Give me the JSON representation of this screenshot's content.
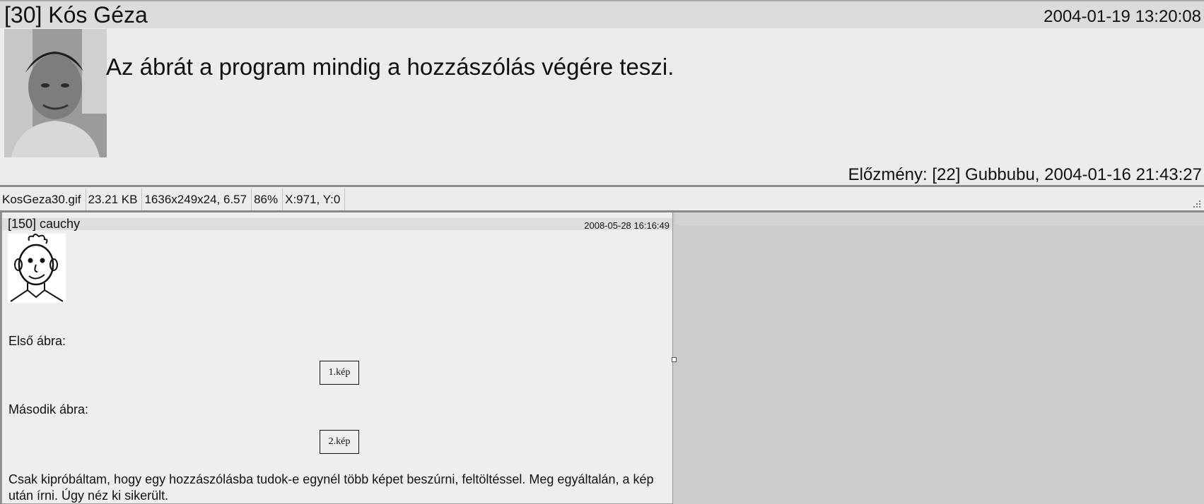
{
  "top_post": {
    "title": "[30] Kós Géza",
    "date": "2004-01-19 13:20:08",
    "body": "Az ábrát a program mindig a hozzászólás végére teszi.",
    "previous": "Előzmény: [22] Gubbubu, 2004-01-16 21:43:27"
  },
  "statusbar": {
    "filename": "KosGeza30.gif",
    "filesize": "23.21 KB",
    "dimensions": "1636x249x24, 6.57",
    "zoom": "86%",
    "coords": "X:971, Y:0"
  },
  "inner_post": {
    "title": "[150] cauchy",
    "date": "2008-05-28 16:16:49",
    "label1": "Első ábra:",
    "image1": "1.kép",
    "label2": "Második ábra:",
    "image2": "2.kép",
    "text": "Csak kipróbáltam, hogy egy hozzászólásba tudok-e egynél több képet beszúrni, feltöltéssel. Meg egyáltalán, a kép után írni. Úgy néz ki sikerült."
  }
}
